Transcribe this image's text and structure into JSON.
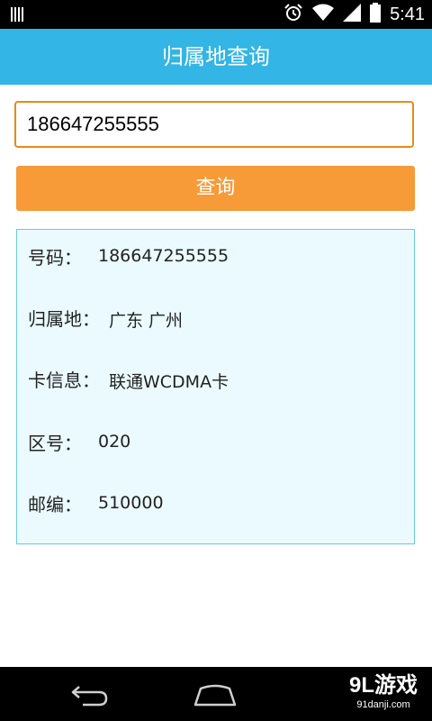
{
  "status_bar": {
    "time": "5:41",
    "icons": [
      "sim-bars-icon",
      "alarm-icon",
      "wifi-icon",
      "signal-icon",
      "battery-icon"
    ]
  },
  "app": {
    "title": "归属地查询"
  },
  "search": {
    "value": "186647255555",
    "button_label": "查询"
  },
  "result": {
    "rows": [
      {
        "label": "号码：",
        "value": "186647255555"
      },
      {
        "label": "归属地：",
        "value": "广东 广州"
      },
      {
        "label": "卡信息：",
        "value": "联通WCDMA卡"
      },
      {
        "label": "区号：",
        "value": "020"
      },
      {
        "label": "邮编：",
        "value": "510000"
      }
    ]
  },
  "watermark": {
    "brand": "9L游戏",
    "url": "91danji.com"
  },
  "colors": {
    "appbar": "#33b5e5",
    "input_border": "#e88a1a",
    "button": "#f79a38",
    "result_bg": "#eafaff",
    "result_border": "#6cc9dc"
  }
}
